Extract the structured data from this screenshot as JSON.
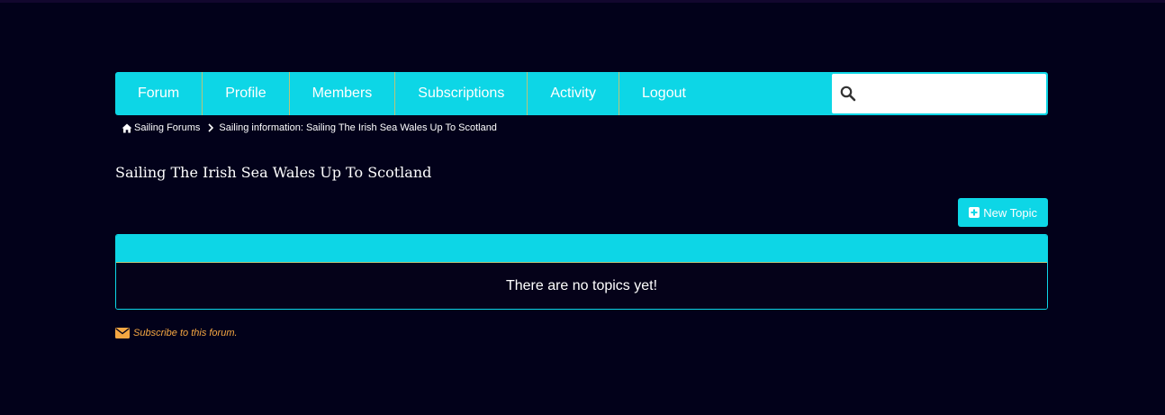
{
  "nav": {
    "items": [
      {
        "label": "Forum"
      },
      {
        "label": "Profile"
      },
      {
        "label": "Members"
      },
      {
        "label": "Subscriptions"
      },
      {
        "label": "Activity"
      },
      {
        "label": "Logout"
      }
    ],
    "search_placeholder": ""
  },
  "breadcrumb": {
    "home": "Sailing Forums",
    "current": "Sailing information: Sailing The Irish Sea Wales Up To Scotland"
  },
  "page": {
    "title": "Sailing The Irish Sea Wales Up To Scotland"
  },
  "actions": {
    "new_topic": "New Topic"
  },
  "topics": {
    "empty_message": "There are no topics yet!"
  },
  "subscribe": {
    "label": "Subscribe to this forum."
  },
  "colors": {
    "background": "#02011a",
    "accent": "#0dd6e6",
    "divider": "#b9c47a",
    "subscribe": "#f5a742"
  },
  "icons": {
    "search": "search-icon",
    "home": "home-icon",
    "separator": "chevron-right-icon",
    "new_topic": "plus-square-icon",
    "subscribe": "envelope-icon"
  }
}
